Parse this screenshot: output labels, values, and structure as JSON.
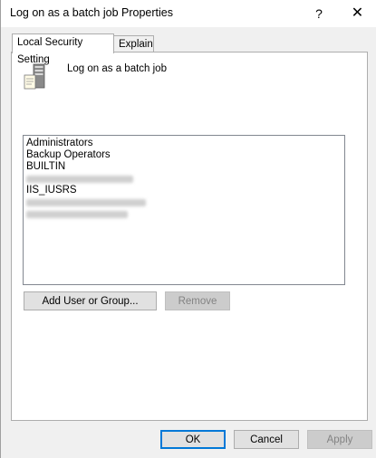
{
  "window": {
    "title": "Log on as a batch job Properties",
    "help_label": "?",
    "close_label": "✕"
  },
  "tabs": [
    {
      "label": "Local Security Setting",
      "active": true
    },
    {
      "label": "Explain",
      "active": false
    }
  ],
  "policy": {
    "name": "Log on as a batch job",
    "icon": "server-icon"
  },
  "members": [
    "Administrators",
    "Backup Operators",
    "BUILTIN",
    "IIS_IUSRS"
  ],
  "buttons": {
    "add_user": "Add User or Group...",
    "remove": "Remove",
    "ok": "OK",
    "cancel": "Cancel",
    "apply": "Apply"
  },
  "colors": {
    "default_button_border": "#0078d7",
    "disabled_text": "#838383"
  }
}
